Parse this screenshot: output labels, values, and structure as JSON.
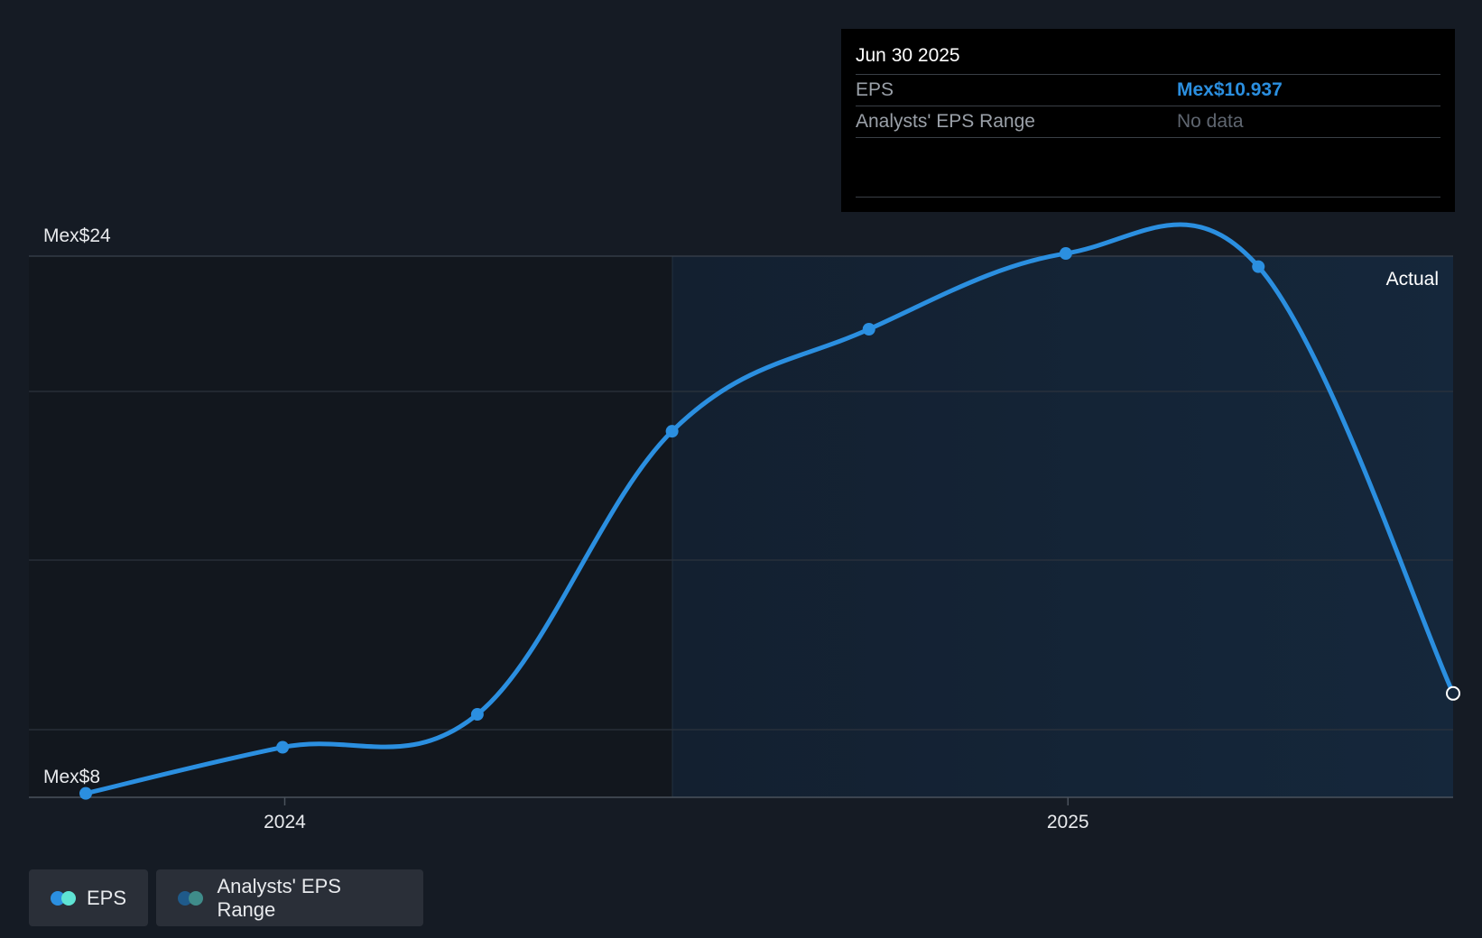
{
  "chart_data": {
    "type": "line",
    "currency_prefix": "Mex$",
    "y_axis": {
      "top_label": "Mex$24",
      "bottom_label": "Mex$8",
      "ylim": [
        8,
        24
      ]
    },
    "x_ticks": [
      "2024",
      "2025"
    ],
    "x_tick_dates": [
      "2024-01-01",
      "2025-01-01"
    ],
    "xlim": [
      "2023-09-30",
      "2025-06-30"
    ],
    "region_label": "Actual",
    "series": [
      {
        "name": "EPS",
        "color": "#2b8fe0",
        "points": [
          {
            "date": "2023-09-30",
            "value": 7.9
          },
          {
            "date": "2023-12-31",
            "value": 9.3
          },
          {
            "date": "2024-03-31",
            "value": 10.3
          },
          {
            "date": "2024-06-30",
            "value": 18.9
          },
          {
            "date": "2024-09-30",
            "value": 22.0
          },
          {
            "date": "2024-12-31",
            "value": 24.3
          },
          {
            "date": "2025-03-31",
            "value": 23.9
          },
          {
            "date": "2025-06-30",
            "value": 10.937
          }
        ]
      }
    ]
  },
  "tooltip": {
    "date": "Jun 30 2025",
    "rows": [
      {
        "label": "EPS",
        "value": "Mex$10.937"
      },
      {
        "label": "Analysts' EPS Range",
        "value": "No data"
      }
    ]
  },
  "legend": {
    "items": [
      {
        "label": "EPS",
        "colors": [
          "#2b8fe0",
          "#5fe3d4"
        ]
      },
      {
        "label": "Analysts' EPS Range",
        "colors": [
          "#1f5a8a",
          "#3f8c8a"
        ]
      }
    ]
  },
  "colors": {
    "background": "#151b24",
    "past_region": "#12171e",
    "future_region": "#142436",
    "grid": "#2c333d",
    "accent": "#2b8fe0"
  }
}
